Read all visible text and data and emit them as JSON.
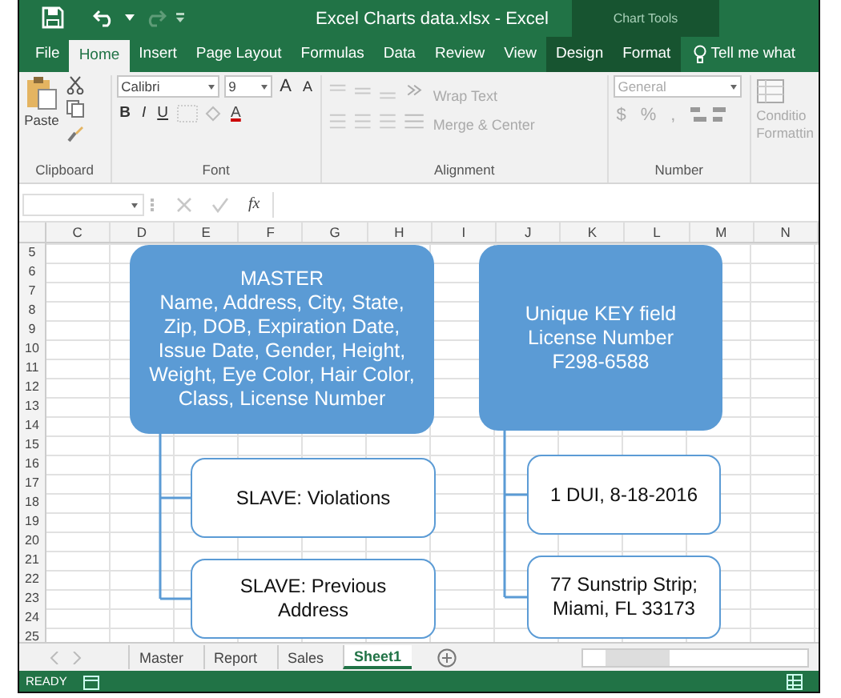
{
  "window": {
    "title": "Excel Charts data.xlsx - Excel",
    "context_title": "Chart Tools"
  },
  "tabs": [
    {
      "label": "File",
      "selected": false,
      "contextual": false
    },
    {
      "label": "Home",
      "selected": true,
      "contextual": false
    },
    {
      "label": "Insert",
      "selected": false,
      "contextual": false
    },
    {
      "label": "Page Layout",
      "selected": false,
      "contextual": false
    },
    {
      "label": "Formulas",
      "selected": false,
      "contextual": false
    },
    {
      "label": "Data",
      "selected": false,
      "contextual": false
    },
    {
      "label": "Review",
      "selected": false,
      "contextual": false
    },
    {
      "label": "View",
      "selected": false,
      "contextual": false
    },
    {
      "label": "Design",
      "selected": false,
      "contextual": true
    },
    {
      "label": "Format",
      "selected": false,
      "contextual": true
    }
  ],
  "tell_me": "Tell me what",
  "ribbon": {
    "clipboard": {
      "paste": "Paste",
      "label": "Clipboard"
    },
    "font": {
      "name": "Calibri",
      "size": "9",
      "label": "Font",
      "bold": "B",
      "italic": "I",
      "underline": "U",
      "grow": "A",
      "shrink": "A",
      "color_letter": "A"
    },
    "alignment": {
      "wrap": "Wrap Text",
      "merge": "Merge & Center",
      "label": "Alignment"
    },
    "number": {
      "format": "General",
      "currency": "$",
      "percent": "%",
      "comma": ",",
      "label": "Number"
    },
    "styles": {
      "line_1": "Conditio",
      "line_2": "Formattin"
    }
  },
  "formula_bar": {
    "fx": "fx"
  },
  "columns": [
    "C",
    "D",
    "E",
    "F",
    "G",
    "H",
    "I",
    "J",
    "K",
    "L",
    "M",
    "N"
  ],
  "rows": [
    "5",
    "6",
    "7",
    "8",
    "9",
    "10",
    "11",
    "12",
    "13",
    "14",
    "15",
    "16",
    "17",
    "18",
    "19",
    "20",
    "21",
    "22",
    "23",
    "24",
    "25"
  ],
  "shapes": [
    {
      "kind": "filled",
      "lines": [
        "MASTER",
        "Name, Address, City, State,",
        "Zip, DOB, Expiration Date,",
        "Issue Date, Gender, Height,",
        "Weight, Eye Color, Hair Color,",
        "Class, License Number"
      ]
    },
    {
      "kind": "filled",
      "lines": [
        "Unique KEY field",
        "License Number",
        "F298-6588"
      ]
    },
    {
      "kind": "outlined",
      "lines": [
        "SLAVE: Violations"
      ]
    },
    {
      "kind": "outlined",
      "lines": [
        "SLAVE: Previous",
        "Address"
      ]
    },
    {
      "kind": "outlined",
      "lines": [
        "1 DUI, 8-18-2016"
      ]
    },
    {
      "kind": "outlined",
      "lines": [
        "77 Sunstrip Strip;",
        "Miami, FL 33173"
      ]
    }
  ],
  "sheet_tabs": [
    {
      "label": "Master",
      "selected": false
    },
    {
      "label": "Report",
      "selected": false
    },
    {
      "label": "Sales",
      "selected": false
    },
    {
      "label": "Sheet1",
      "selected": true
    }
  ],
  "status_bar": {
    "mode": "READY"
  }
}
